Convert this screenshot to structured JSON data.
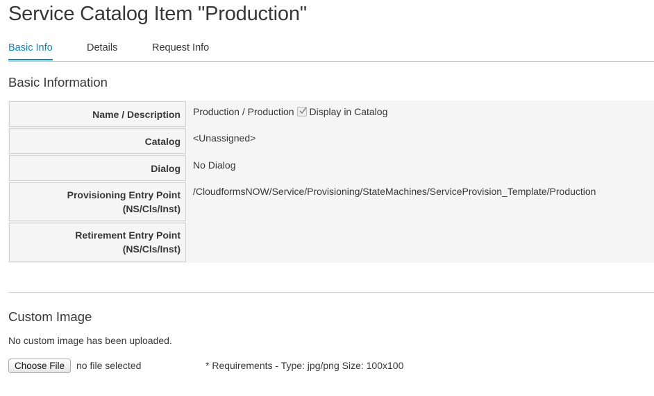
{
  "page": {
    "title": "Service Catalog Item \"Production\""
  },
  "tabs": [
    {
      "label": "Basic Info",
      "active": true
    },
    {
      "label": "Details",
      "active": false
    },
    {
      "label": "Request Info",
      "active": false
    }
  ],
  "basic_information": {
    "heading": "Basic Information",
    "rows": [
      {
        "label": "Name / Description",
        "value": "Production / Production",
        "checkbox_label": "Display in Catalog",
        "checkbox_checked": true
      },
      {
        "label": "Catalog",
        "value": "<Unassigned>"
      },
      {
        "label": "Dialog",
        "value": "No Dialog"
      },
      {
        "label_line1": "Provisioning Entry Point",
        "label_line2": "(NS/Cls/Inst)",
        "value": "/CloudformsNOW/Service/Provisioning/StateMachines/ServiceProvision_Template/Production"
      },
      {
        "label_line1": "Retirement Entry Point",
        "label_line2": "(NS/Cls/Inst)",
        "value": ""
      }
    ]
  },
  "custom_image": {
    "heading": "Custom Image",
    "status_text": "No custom image has been uploaded.",
    "choose_file_label": "Choose File",
    "file_status": "no file selected",
    "requirements": "* Requirements - Type: jpg/png Size: 100x100"
  },
  "colors": {
    "accent": "#0088ce",
    "table_background": "#f5f5f5",
    "border": "#d1d1d1"
  }
}
